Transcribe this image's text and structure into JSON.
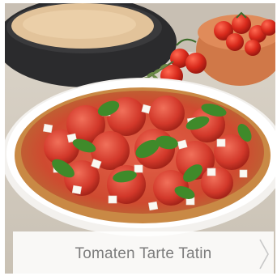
{
  "recipe_card": {
    "caption": "Tomaten Tarte Tatin",
    "image_subject": "tomato-tarte-tatin-photo"
  },
  "icons": {
    "next": "chevron-right-icon"
  },
  "colors": {
    "caption_text": "#7d7d7d",
    "caption_background": "#ffffff",
    "chevron": "#c8c8c8"
  }
}
